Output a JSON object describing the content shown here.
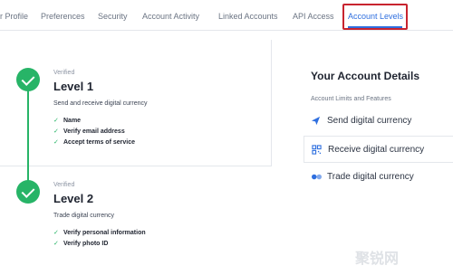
{
  "tabs": [
    {
      "label": "r Profile"
    },
    {
      "label": "Preferences"
    },
    {
      "label": "Security"
    },
    {
      "label": "Account Activity"
    },
    {
      "label": "Linked Accounts"
    },
    {
      "label": "API Access"
    },
    {
      "label": "Account Levels"
    }
  ],
  "levels": [
    {
      "status": "Verified",
      "title": "Level 1",
      "description": "Send and receive digital currency",
      "requirements": [
        "Name",
        "Verify email address",
        "Accept terms of service"
      ]
    },
    {
      "status": "Verified",
      "title": "Level 2",
      "description": "Trade digital currency",
      "requirements": [
        "Verify personal information",
        "Verify photo ID"
      ]
    }
  ],
  "details": {
    "title": "Your Account Details",
    "subtitle": "Account Limits and Features",
    "items": [
      {
        "label": "Send digital currency",
        "icon": "send-icon"
      },
      {
        "label": "Receive digital currency",
        "icon": "qr-code-icon"
      },
      {
        "label": "Trade digital currency",
        "icon": "trade-icon"
      }
    ]
  },
  "watermark": "聚锐网",
  "colors": {
    "accent": "#2f6fdf",
    "success": "#27b467",
    "highlight": "#c8242f"
  }
}
